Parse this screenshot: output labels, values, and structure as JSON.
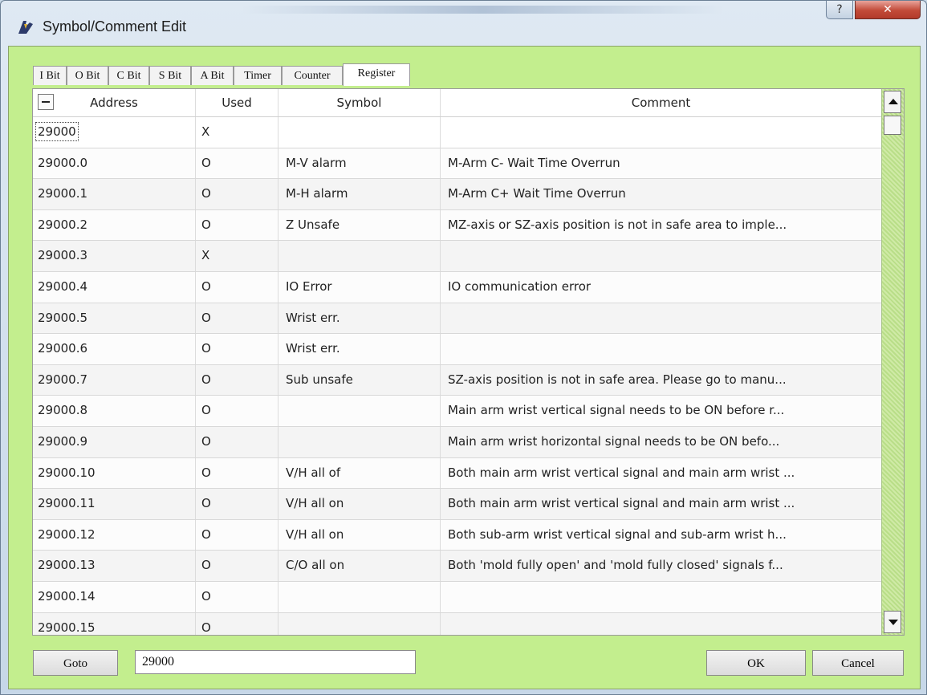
{
  "window": {
    "title": "Symbol/Comment Edit"
  },
  "titlebar": {
    "help_label": "?",
    "close_label": "✕"
  },
  "tabs": [
    {
      "label": "I Bit"
    },
    {
      "label": "O Bit"
    },
    {
      "label": "C Bit"
    },
    {
      "label": "S Bit"
    },
    {
      "label": "A Bit"
    },
    {
      "label": "Timer"
    },
    {
      "label": "Counter"
    },
    {
      "label": "Register",
      "active": true
    }
  ],
  "table": {
    "headers": {
      "address": "Address",
      "used": "Used",
      "symbol": "Symbol",
      "comment": "Comment"
    },
    "rows": [
      {
        "address": "29000",
        "used": "X",
        "symbol": "",
        "comment": ""
      },
      {
        "address": "29000.0",
        "used": "O",
        "symbol": "M-V alarm",
        "comment": "M-Arm C- Wait Time Overrun"
      },
      {
        "address": "29000.1",
        "used": "O",
        "symbol": "M-H alarm",
        "comment": "M-Arm C+ Wait Time Overrun"
      },
      {
        "address": "29000.2",
        "used": "O",
        "symbol": "Z Unsafe",
        "comment": "MZ-axis or SZ-axis position is not in safe area to imple..."
      },
      {
        "address": "29000.3",
        "used": "X",
        "symbol": "",
        "comment": ""
      },
      {
        "address": "29000.4",
        "used": "O",
        "symbol": "IO Error",
        "comment": "IO communication error"
      },
      {
        "address": "29000.5",
        "used": "O",
        "symbol": "Wrist err.",
        "comment": ""
      },
      {
        "address": "29000.6",
        "used": "O",
        "symbol": "Wrist err.",
        "comment": ""
      },
      {
        "address": "29000.7",
        "used": "O",
        "symbol": "Sub unsafe",
        "comment": "SZ-axis position is not in safe area. Please go to manu..."
      },
      {
        "address": "29000.8",
        "used": "O",
        "symbol": "",
        "comment": "Main arm wrist vertical signal needs to be ON before r..."
      },
      {
        "address": "29000.9",
        "used": "O",
        "symbol": "",
        "comment": "Main arm wrist horizontal signal needs to be ON befo..."
      },
      {
        "address": "29000.10",
        "used": "O",
        "symbol": "V/H all of",
        "comment": "Both main arm wrist vertical signal and main arm wrist ..."
      },
      {
        "address": "29000.11",
        "used": "O",
        "symbol": "V/H all on",
        "comment": "Both main arm wrist vertical signal and main arm wrist ..."
      },
      {
        "address": "29000.12",
        "used": "O",
        "symbol": "V/H all on",
        "comment": "Both sub-arm wrist vertical signal and sub-arm wrist h..."
      },
      {
        "address": "29000.13",
        "used": "O",
        "symbol": "C/O all on",
        "comment": "Both 'mold fully open' and 'mold fully closed' signals f..."
      },
      {
        "address": "29000.14",
        "used": "O",
        "symbol": "",
        "comment": ""
      },
      {
        "address": "29000.15",
        "used": "O",
        "symbol": "",
        "comment": ""
      }
    ]
  },
  "footer": {
    "goto_label": "Goto",
    "goto_value": "29000",
    "ok_label": "OK",
    "cancel_label": "Cancel"
  }
}
